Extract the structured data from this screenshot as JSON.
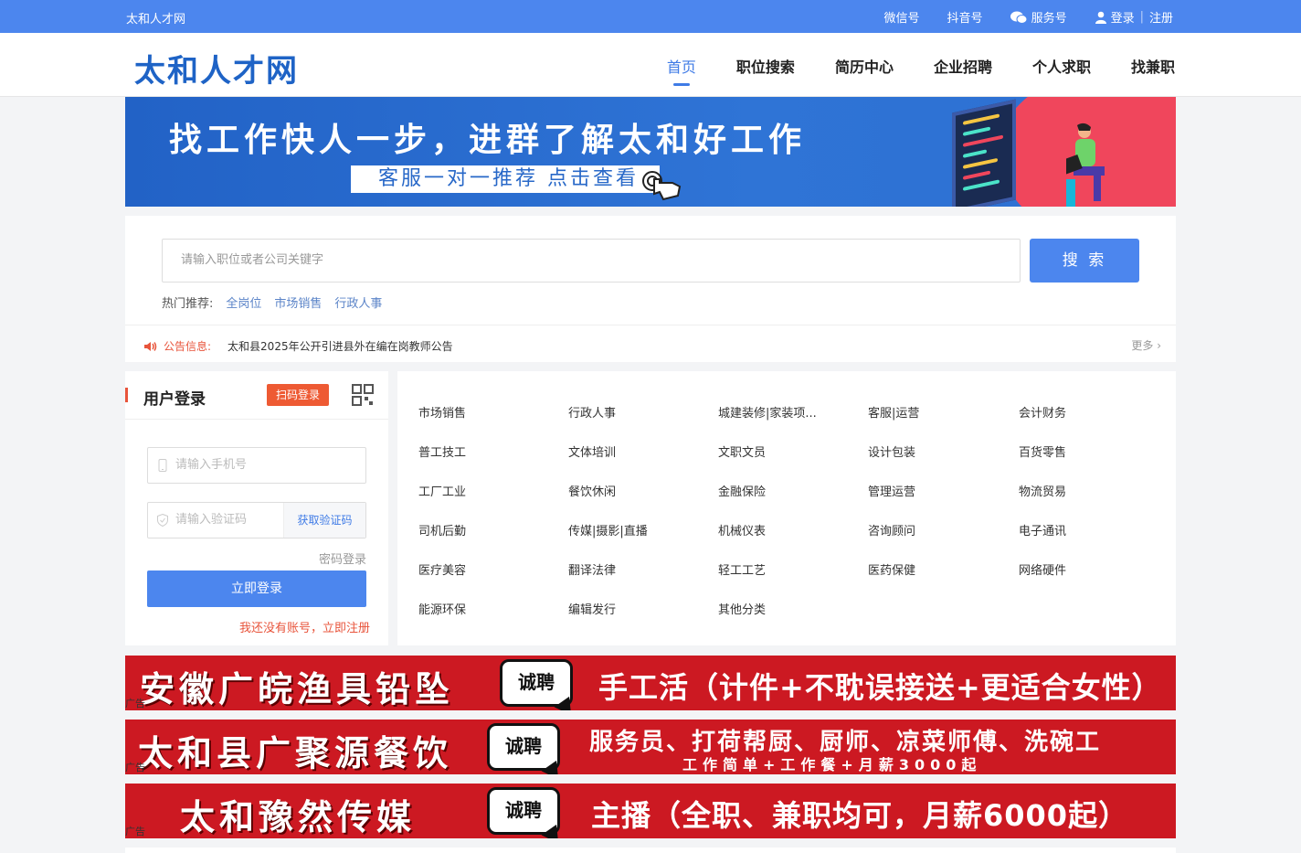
{
  "topbar": {
    "site_name": "太和人才网",
    "links": [
      "微信号",
      "抖音号",
      "服务号"
    ],
    "login": "登录",
    "register": "注册"
  },
  "header": {
    "logo": "太和人才网",
    "nav": [
      "首页",
      "职位搜索",
      "简历中心",
      "企业招聘",
      "个人求职",
      "找兼职"
    ],
    "active_nav": "首页"
  },
  "banner": {
    "headline": "找工作快人一步，进群了解太和好工作",
    "subline": "客服一对一推荐 点击查看"
  },
  "search": {
    "placeholder": "请输入职位或者公司关键字",
    "button": "搜 索",
    "hot_label": "热门推荐:",
    "hot_keywords": [
      "全岗位",
      "市场销售",
      "行政人事"
    ]
  },
  "notice": {
    "label": "公告信息:",
    "text": "太和县2025年公开引进县外在编在岗教师公告",
    "more": "更多 ›"
  },
  "login": {
    "title": "用户登录",
    "scan_button": "扫码登录",
    "phone_placeholder": "请输入手机号",
    "code_placeholder": "请输入验证码",
    "get_code": "获取验证码",
    "password_login": "密码登录",
    "submit": "立即登录",
    "register_link": "我还没有账号，立即注册"
  },
  "categories": [
    [
      "市场销售",
      "行政人事",
      "城建装修|家装项...",
      "客服|运营",
      "会计财务"
    ],
    [
      "普工技工",
      "文体培训",
      "文职文员",
      "设计包装",
      "百货零售"
    ],
    [
      "工厂工业",
      "餐饮休闲",
      "金融保险",
      "管理运营",
      "物流贸易"
    ],
    [
      "司机后勤",
      "传媒|摄影|直播",
      "机械仪表",
      "咨询顾问",
      "电子通讯"
    ],
    [
      "医疗美容",
      "翻译法律",
      "轻工工艺",
      "医药保健",
      "网络硬件"
    ],
    [
      "能源环保",
      "编辑发行",
      "其他分类"
    ]
  ],
  "ads": [
    {
      "tag": "广告",
      "company": "安徽广皖渔具铅坠",
      "hire": "诚聘",
      "desc": "手工活（计件+不耽误接送+更适合女性）"
    },
    {
      "tag": "广告",
      "company": "太和县广聚源餐饮",
      "hire": "诚聘",
      "desc": "服务员、打荷帮厨、厨师、凉菜师傅、洗碗工",
      "sub": "工作简单+工作餐+月薪3000起"
    },
    {
      "tag": "广告",
      "company": "太和豫然传媒",
      "hire": "诚聘",
      "desc": "主播（全职、兼职均可，月薪6000起）"
    }
  ],
  "colors": {
    "primary": "#4c86ee",
    "logo": "#1e63c6",
    "accent": "#e8543b",
    "ad_red": "#cc1922"
  }
}
